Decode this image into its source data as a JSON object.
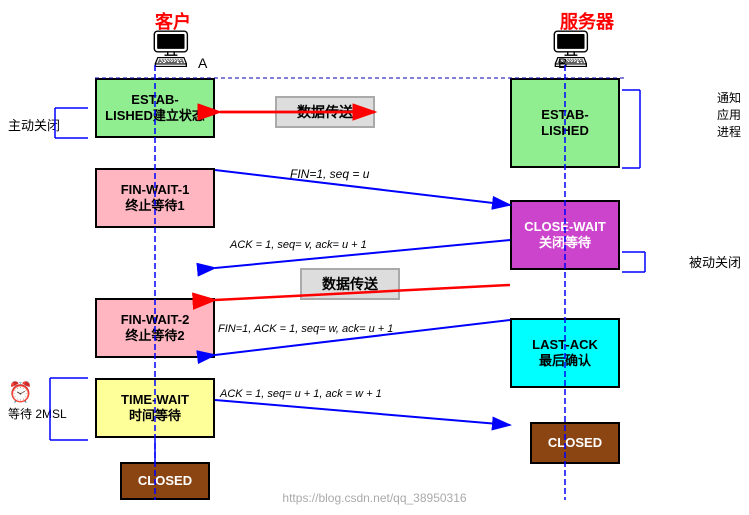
{
  "title": {
    "client": "客户",
    "server": "服务器"
  },
  "labels": {
    "a": "A",
    "b": "B",
    "zhudong": "主动关闭",
    "beidong": "被动关闭",
    "notify": "通知\n应用\n进程",
    "wait2msl": "等待 2MSL"
  },
  "states": {
    "established_left": "ESTAB-\nLISHED建立状态",
    "established_right": "ESTAB-\nLISHED",
    "finwait1": "FIN-WAIT-1\n终止等待1",
    "finwait2": "FIN-WAIT-2\n终止等待2",
    "timewait": "TIME-WAIT\n时间等待",
    "closewait": "CLOSE-WAIT\n关闭等待",
    "lastack": "LAST-ACK\n最后确认",
    "closed_left": "CLOSED",
    "closed_right": "CLOSED"
  },
  "messages": {
    "fin1": "FIN=1, seq = u",
    "ack1": "ACK = 1, seq= v, ack= u + 1",
    "data": "数据传送",
    "fin2": "FIN=1, ACK = 1, seq= w, ack= u + 1",
    "ack2": "ACK = 1, seq= u + 1, ack = w + 1"
  },
  "watermark": "https://blog.csdn.net/qq_38950316"
}
